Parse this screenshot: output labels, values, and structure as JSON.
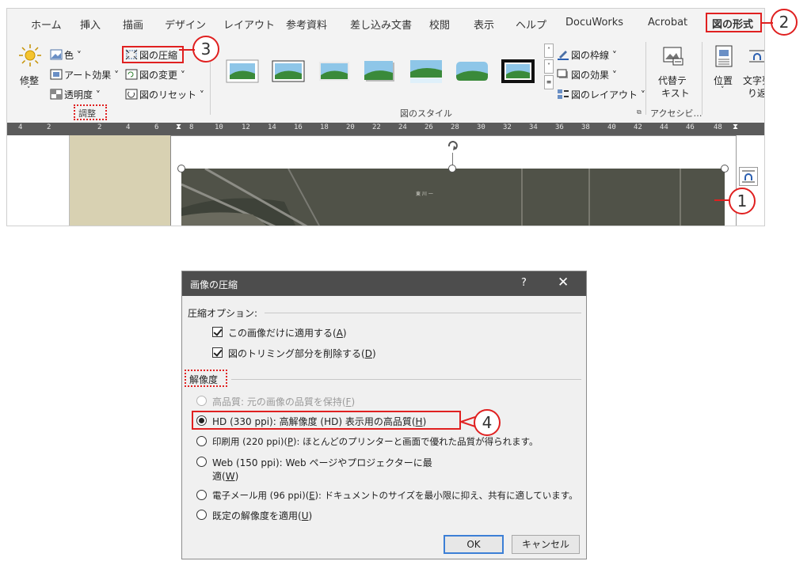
{
  "ribbon": {
    "tabs": [
      "ホーム",
      "挿入",
      "描画",
      "デザイン",
      "レイアウト",
      "参考資料",
      "差し込み文書",
      "校閲",
      "表示",
      "ヘルプ",
      "DocuWorks",
      "Acrobat",
      "図の形式"
    ],
    "adjust_group": {
      "corrections": "修整",
      "color": "色 ˅",
      "artistic_effects": "アート効果 ˅",
      "transparency": "透明度 ˅",
      "compress_pictures": "図の圧縮",
      "change_picture": "図の変更 ˅",
      "reset_picture": "図のリセット ˅",
      "label": "調整"
    },
    "styles_group": {
      "picture_border": "図の枠線 ˅",
      "picture_effects": "図の効果 ˅",
      "picture_layout": "図のレイアウト ˅",
      "label": "図のスタイル"
    },
    "accessibility_group": {
      "alt_text_line1": "代替テ",
      "alt_text_line2": "キスト",
      "label": "アクセシビ…"
    },
    "arrange_group": {
      "position": "位置",
      "wrap_text_line1": "文字列",
      "wrap_text_line2": "り返し"
    },
    "ruler_ticks": [
      "4",
      "2",
      "2",
      "4",
      "6",
      "8",
      "10",
      "12",
      "14",
      "16",
      "18",
      "20",
      "22",
      "24",
      "26",
      "28",
      "30",
      "32",
      "34",
      "36",
      "38",
      "40",
      "42",
      "44",
      "46",
      "48"
    ],
    "map_label": "東 川 一"
  },
  "annotations": {
    "c1": "1",
    "c2": "2",
    "c3": "3",
    "c4": "4"
  },
  "dialog": {
    "title": "画像の圧縮",
    "help": "?",
    "close": "✕",
    "compression_options_label": "圧縮オプション:",
    "apply_only_this_picture": {
      "text": "この画像だけに適用する(",
      "key": "A",
      "end": ")",
      "checked": true
    },
    "delete_cropped_areas": {
      "text": "図のトリミング部分を削除する(",
      "key": "D",
      "end": ")",
      "checked": true
    },
    "resolution_label": "解像度",
    "options": [
      {
        "text": "高品質: 元の画像の品質を保持(",
        "key": "F",
        "end": ")",
        "selected": false,
        "disabled": true
      },
      {
        "text": "HD (330 ppi): 高解像度 (HD) 表示用の高品質(",
        "key": "H",
        "end": ")",
        "selected": true,
        "disabled": false
      },
      {
        "text": "印刷用 (220 ppi)(",
        "key": "P",
        "end": "): ほとんどのプリンターと画面で優れた品質が得られます。",
        "selected": false,
        "disabled": false
      },
      {
        "text": "Web (150 ppi): Web ページやプロジェクターに最",
        "line2a": "適(",
        "key": "W",
        "end": ")",
        "selected": false,
        "disabled": false
      },
      {
        "text": "電子メール用 (96 ppi)(",
        "key": "E",
        "end": "): ドキュメントのサイズを最小限に抑え、共有に適しています。",
        "selected": false,
        "disabled": false
      },
      {
        "text": "既定の解像度を適用(",
        "key": "U",
        "end": ")",
        "selected": false,
        "disabled": false
      }
    ],
    "ok": "OK",
    "cancel": "キャンセル"
  },
  "colors": {
    "accent_red": "#e02020",
    "titlebar": "#4d4d4d",
    "ok_border": "#3c7fd6"
  }
}
